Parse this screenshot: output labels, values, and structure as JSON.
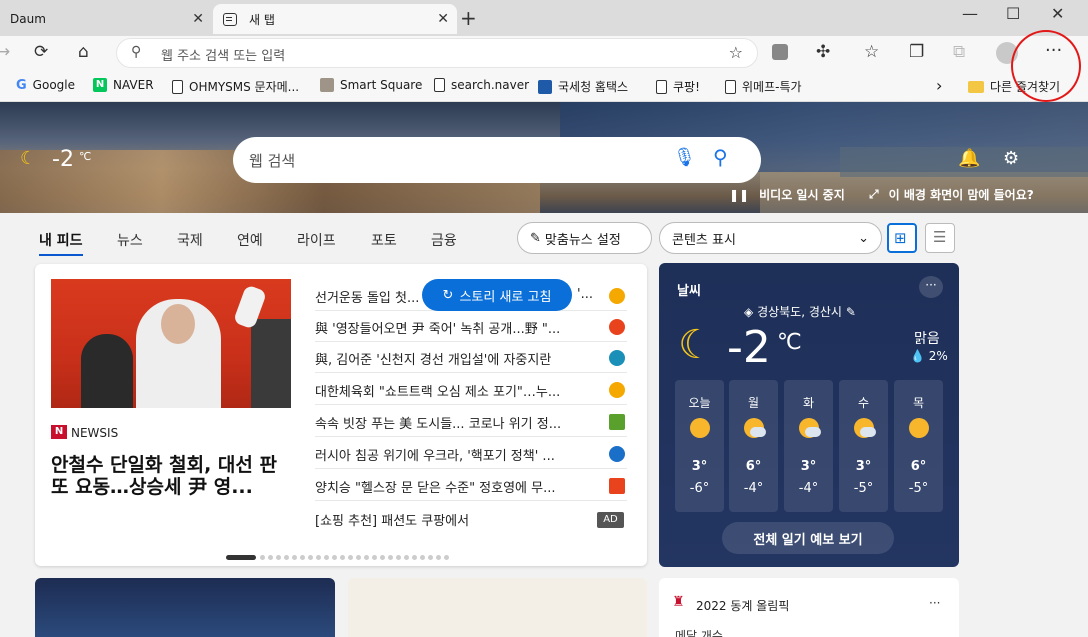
{
  "browser": {
    "tabs": [
      {
        "label": "Daum",
        "close": "✕"
      },
      {
        "label": "새 탭",
        "close": "✕"
      }
    ],
    "new_tab": "+",
    "window": {
      "minimize": "—",
      "maximize": "☐",
      "close": "✕"
    },
    "address_placeholder": "웹 주소 검색 또는 입력",
    "bookmarks": [
      {
        "label": "Google",
        "icon": "google-icon"
      },
      {
        "label": "NAVER",
        "icon": "naver-icon"
      },
      {
        "label": "OHMYSMS 문자메...",
        "icon": "page-icon"
      },
      {
        "label": "Smart Square",
        "icon": "smart-square-icon"
      },
      {
        "label": "search.naver",
        "icon": "page-icon"
      },
      {
        "label": "국세청 홈택스",
        "icon": "hometax-icon"
      },
      {
        "label": "쿠팡!",
        "icon": "page-icon"
      },
      {
        "label": "위메프-특가",
        "icon": "page-icon"
      }
    ],
    "bookmarks_overflow": "›",
    "other_favorites": "다른 즐겨찾기"
  },
  "hero": {
    "temperature": "-2",
    "unit": "℃",
    "search_placeholder": "웹 검색",
    "pause_video": "비디오 일시 중지",
    "like_background": "이 배경 화면이 맘에 들어요?"
  },
  "feed_nav": {
    "tabs": [
      "내 피드",
      "뉴스",
      "국제",
      "연예",
      "라이프",
      "포토",
      "금융"
    ],
    "personalize": "맞춤뉴스 설정",
    "content_display": "콘텐츠 표시"
  },
  "main_story": {
    "source": "NEWSIS",
    "source_badge": "N",
    "headline": "안철수 단일화 철회, 대선 판 또 요동…상승세 尹 영...",
    "refresh_button": "스토리 새로 고침",
    "ad_label": "AD",
    "news": [
      {
        "title": "선거운동 돌입 첫...",
        "suffix": "'...",
        "source_color": "#f5a800"
      },
      {
        "title": "與 '영장들어오면 尹 죽어' 녹취 공개...野 \"...",
        "source_color": "#e8431c"
      },
      {
        "title": "與, 김어준 '신천지 경선 개입설'에 자중지란",
        "source_color": "#1a8fb8"
      },
      {
        "title": "대한체육회 \"쇼트트랙 오심 제소 포기\"…누...",
        "source_color": "#f5a800"
      },
      {
        "title": "속속 빗장 푸는 美 도시들... 코로나 위기 정...",
        "source_color": "#5aa02c"
      },
      {
        "title": "러시아 침공 위기에 우크라, '핵포기 정책' ...",
        "source_color": "#1a6fc8"
      },
      {
        "title": "양치승 \"헬스장 문 닫은 수준\" 정호영에 무...",
        "source_color": "#e8431c"
      },
      {
        "title": "[쇼핑 추천] 패션도 쿠팡에서",
        "source_color": "#555555"
      }
    ]
  },
  "weather": {
    "title": "날씨",
    "more": "···",
    "location": "경상북도, 경산시",
    "temperature": "-2",
    "unit": "℃",
    "condition": "맑음",
    "precip": "2%",
    "days": [
      {
        "name": "오늘",
        "high": "3°",
        "low": "-6°",
        "cloud": false
      },
      {
        "name": "월",
        "high": "6°",
        "low": "-4°",
        "cloud": true
      },
      {
        "name": "화",
        "high": "3°",
        "low": "-4°",
        "cloud": true
      },
      {
        "name": "수",
        "high": "3°",
        "low": "-5°",
        "cloud": true
      },
      {
        "name": "목",
        "high": "6°",
        "low": "-5°",
        "cloud": false
      }
    ],
    "forecast_button": "전체 일기 예보 보기"
  },
  "olympics": {
    "title": "2022 동계 올림픽",
    "more": "···",
    "sub": "메달 개수"
  }
}
